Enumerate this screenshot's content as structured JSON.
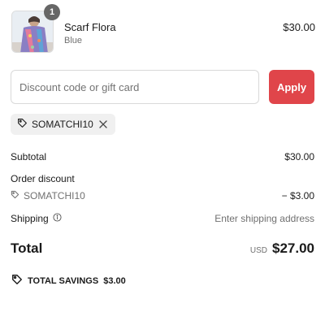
{
  "cart_item": {
    "quantity": "1",
    "name": "Scarf Flora",
    "variant": "Blue",
    "price": "$30.00"
  },
  "discount": {
    "placeholder": "Discount code or gift card",
    "value": "",
    "apply_label": "Apply",
    "applied_code": "SOMATCHI10"
  },
  "summary": {
    "subtotal_label": "Subtotal",
    "subtotal_value": "$30.00",
    "order_discount_label": "Order discount",
    "discount_code": "SOMATCHI10",
    "discount_value": "− $3.00",
    "shipping_label": "Shipping",
    "shipping_value": "Enter shipping address",
    "total_label": "Total",
    "currency": "USD",
    "total_value": "$27.00",
    "savings_label": "TOTAL SAVINGS",
    "savings_value": "$3.00"
  },
  "colors": {
    "accent": "#e0454a",
    "muted_text": "#707070",
    "chip_bg": "#f0f0f0"
  },
  "icons": [
    "tag-icon",
    "close-icon",
    "info-icon"
  ]
}
